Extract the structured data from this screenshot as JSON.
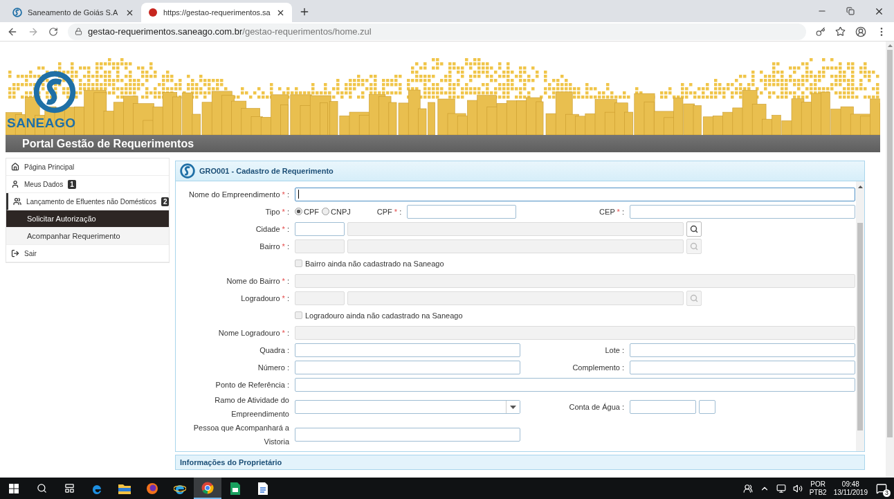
{
  "browser": {
    "tabs": [
      {
        "title": "Saneamento de Goiás S.A",
        "selected": false
      },
      {
        "title": "https://gestao-requerimentos.sa",
        "selected": true
      }
    ],
    "address": {
      "host": "gestao-requerimentos.saneago.com.br",
      "path": "/gestao-requerimentos/home.zul"
    }
  },
  "header": {
    "logo": "SANEAGO",
    "title": "Portal Gestão de Requerimentos"
  },
  "sidebar": {
    "items": [
      {
        "kind": "home",
        "label": "Página Principal",
        "expanded": false
      },
      {
        "kind": "user",
        "label": "Meus Dados",
        "badge": "1",
        "expanded": false
      },
      {
        "kind": "users",
        "label": "Lançamento de Efluentes não Domésticos",
        "badge": "2",
        "expanded": true,
        "children": [
          {
            "label": "Solicitar Autorização",
            "selected": true
          },
          {
            "label": "Acompanhar Requerimento",
            "selected": false
          }
        ]
      },
      {
        "kind": "exit",
        "label": "Sair",
        "expanded": false
      }
    ]
  },
  "panel": {
    "title": "GRO001 - Cadastro de Requerimento",
    "next_section": "Informações do Proprietário",
    "rows": [
      {
        "kind": "field",
        "label": "Nome do Empreendimento",
        "mark": "*",
        "colon": ":",
        "disabled": false,
        "focused": true
      },
      {
        "kind": "radio",
        "label": "Tipo",
        "mark": "*",
        "colon": ":",
        "options": [
          {
            "label": "CPF",
            "selected": true
          },
          {
            "label": "CNPJ",
            "selected": false
          }
        ],
        "middle": {
          "label": "CPF",
          "mark": "*",
          "colon": ":"
        },
        "right": {
          "label": "CEP",
          "mark": "*",
          "colon": ":"
        }
      },
      {
        "kind": "lookup",
        "label": "Cidade",
        "mark": "*",
        "colon": ":",
        "disabled": false
      },
      {
        "kind": "lookup",
        "label": "Bairro",
        "mark": "*",
        "colon": ":",
        "disabled": true
      },
      {
        "kind": "checkbox",
        "label": "Bairro ainda não cadastrado na Saneago",
        "checked": false,
        "disabled": true
      },
      {
        "kind": "field",
        "label": "Nome do Bairro",
        "mark": "*",
        "colon": ":",
        "disabled": true,
        "focused": false
      },
      {
        "kind": "lookup",
        "label": "Logradouro",
        "mark": "*",
        "colon": ":",
        "disabled": true
      },
      {
        "kind": "checkbox",
        "label": "Logradouro ainda não cadastrado na Saneago",
        "checked": false,
        "disabled": true
      },
      {
        "kind": "field",
        "label": "Nome Logradouro",
        "mark": "*",
        "colon": ":",
        "disabled": true,
        "focused": false
      },
      {
        "kind": "pair",
        "label": "Quadra",
        "colon": ":",
        "right": {
          "label": "Lote",
          "colon": ":"
        }
      },
      {
        "kind": "pair",
        "label": "Número",
        "colon": ":",
        "right": {
          "label": "Complemento",
          "colon": ":"
        }
      },
      {
        "kind": "field",
        "label": "Ponto de Referência",
        "colon": ":",
        "disabled": false,
        "focused": false
      },
      {
        "kind": "select",
        "label": "Ramo de Atividade do Empreendimento",
        "right": {
          "label": "Conta de Água",
          "colon": ":"
        }
      },
      {
        "kind": "half",
        "label": "Pessoa que Acompanhará a Vistoria"
      }
    ]
  },
  "taskbar": {
    "apps": [
      {
        "kind": "windows",
        "selected": false
      },
      {
        "kind": "search",
        "selected": false
      },
      {
        "kind": "taskview",
        "selected": false
      },
      {
        "kind": "edge",
        "selected": false
      },
      {
        "kind": "explorer",
        "selected": false
      },
      {
        "kind": "firefox",
        "selected": false
      },
      {
        "kind": "ie",
        "selected": false
      },
      {
        "kind": "chrome",
        "selected": true
      },
      {
        "kind": "sheet",
        "selected": false
      },
      {
        "kind": "doc",
        "selected": false
      }
    ],
    "tray": {
      "language": "POR",
      "layout": "PTB2",
      "time": "09:48",
      "date": "13/11/2019",
      "notifications": "3"
    }
  }
}
